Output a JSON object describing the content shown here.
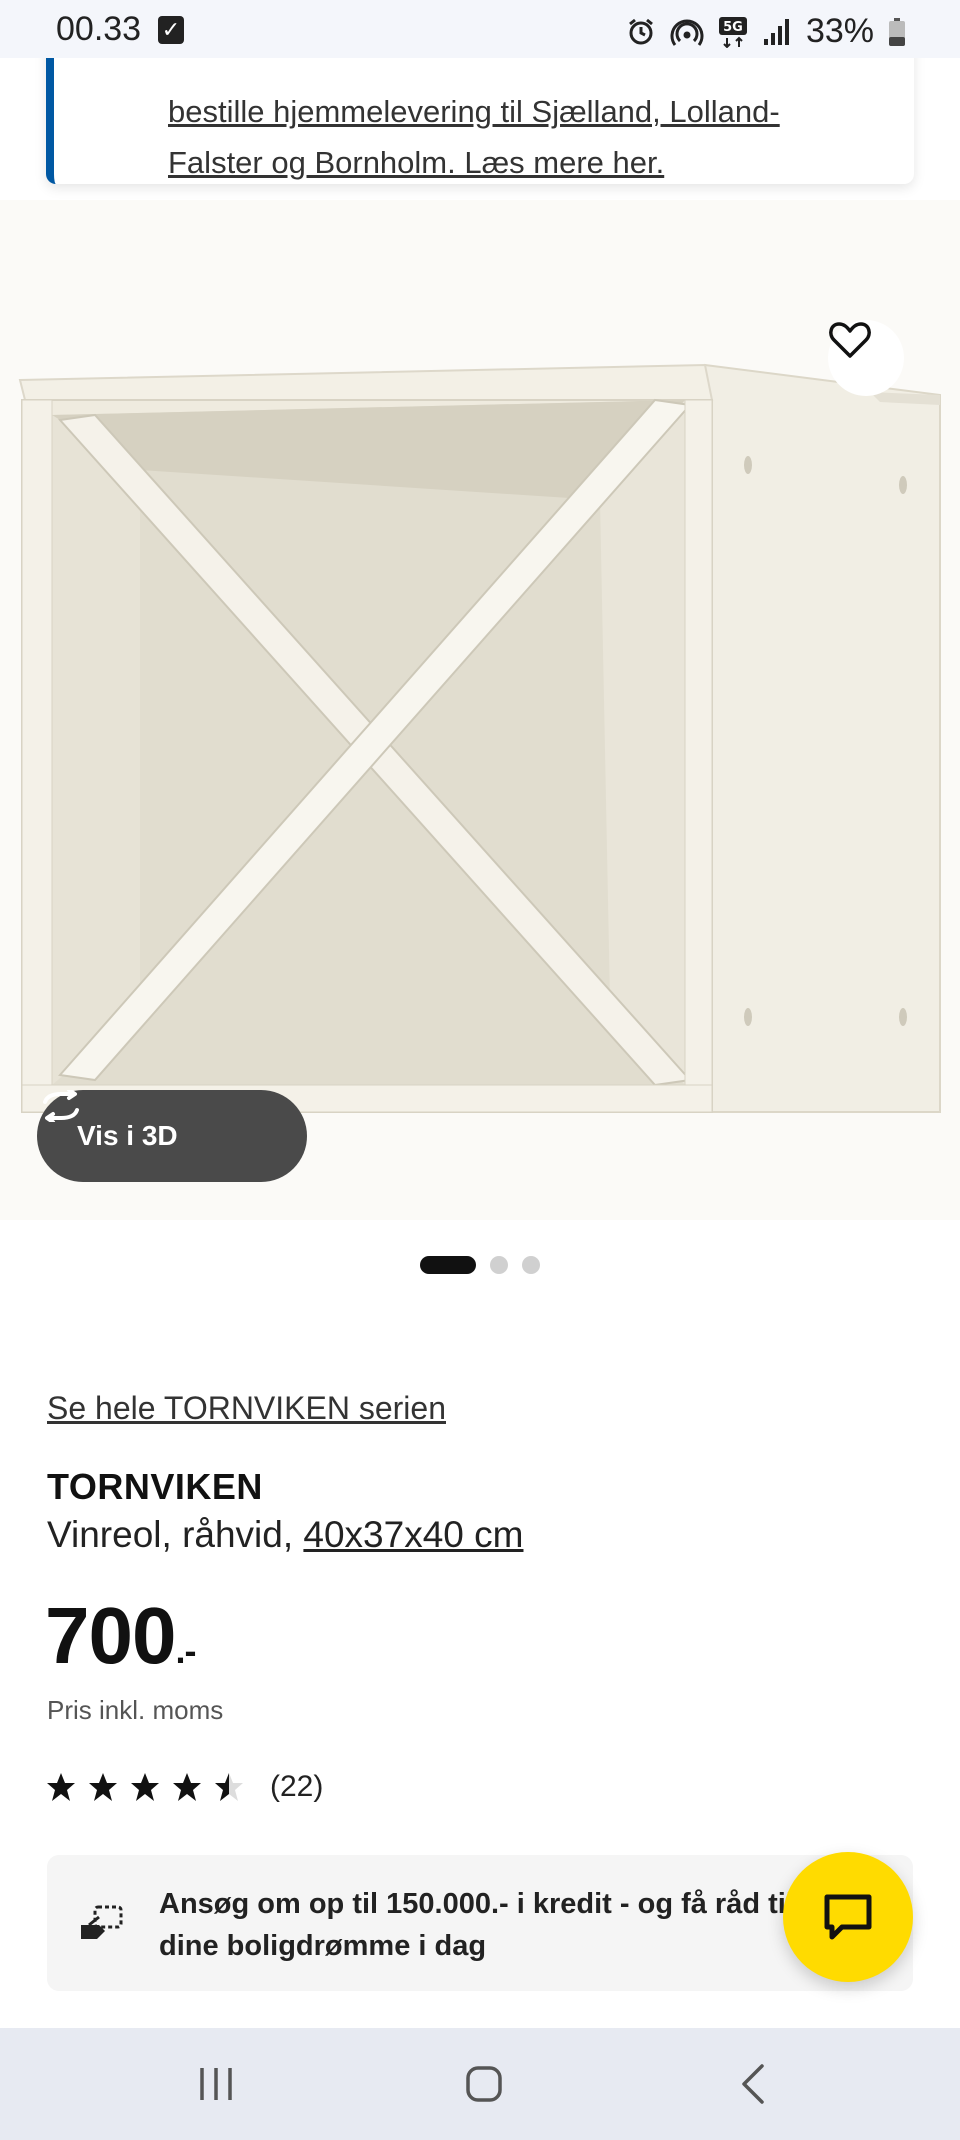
{
  "status_bar": {
    "time": "00.33",
    "battery": "33%",
    "icons": [
      "checkbox-notification-icon",
      "alarm-icon",
      "hotspot-icon",
      "5g-icon",
      "signal-icon",
      "battery-icon"
    ]
  },
  "banner": {
    "line1": "bestille hjemmelevering til Sjælland, Lolland-",
    "line2": "Falster og Bornholm. Læs mere her.",
    "accent_color": "#0058a3"
  },
  "gallery": {
    "view_3d_label": "Vis i 3D",
    "slide_count": 3,
    "active_slide": 1,
    "favorite_icon": "heart-outline-icon"
  },
  "product": {
    "series_link": "Se hele TORNVIKEN serien",
    "name": "TORNVIKEN",
    "description_prefix": "Vinreol, råhvid, ",
    "size": "40x37x40 cm",
    "price": "700",
    "price_suffix": ".-",
    "price_note": "Pris inkl. moms",
    "rating_value": 4.5,
    "rating_max": 5,
    "rating_count": "(22)"
  },
  "credit": {
    "line1": "Ansøg om op til 150.000.- i kredit - og få råd til",
    "line2": "dine boligdrømme i dag"
  },
  "chat": {
    "icon": "chat-bubble-icon",
    "color": "#ffdb00"
  },
  "nav": {
    "icons": [
      "recent-apps-icon",
      "home-icon",
      "back-icon"
    ]
  }
}
